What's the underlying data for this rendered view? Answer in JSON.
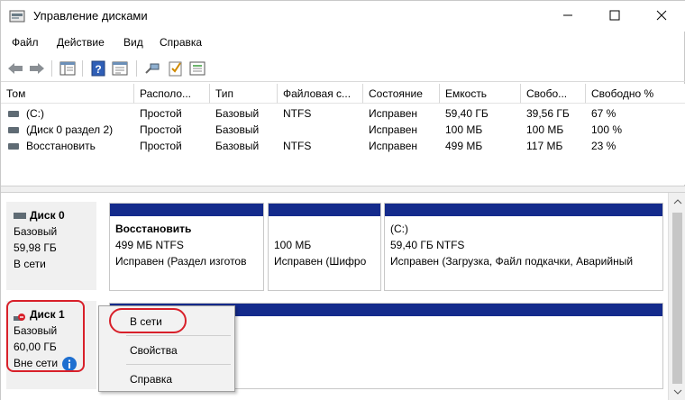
{
  "window": {
    "title": "Управление дисками",
    "icon": "disk-management-icon"
  },
  "menu": [
    "Файл",
    "Действие",
    "Вид",
    "Справка"
  ],
  "toolbar_icons": [
    "back-arrow-icon",
    "forward-arrow-icon",
    "console-tree-icon",
    "help-icon",
    "properties-icon",
    "refresh-icon",
    "checklist-icon",
    "list-view-icon"
  ],
  "columns": [
    "Том",
    "Располо...",
    "Тип",
    "Файловая с...",
    "Состояние",
    "Емкость",
    "Свобо...",
    "Свободно %"
  ],
  "volumes": [
    {
      "name": "(C:)",
      "layout": "Простой",
      "type": "Базовый",
      "fs": "NTFS",
      "status": "Исправен",
      "capacity": "59,40 ГБ",
      "free": "39,56 ГБ",
      "free_pct": "67 %"
    },
    {
      "name": "(Диск 0 раздел 2)",
      "layout": "Простой",
      "type": "Базовый",
      "fs": "",
      "status": "Исправен",
      "capacity": "100 МБ",
      "free": "100 МБ",
      "free_pct": "100 %"
    },
    {
      "name": "Восстановить",
      "layout": "Простой",
      "type": "Базовый",
      "fs": "NTFS",
      "status": "Исправен",
      "capacity": "499 МБ",
      "free": "117 МБ",
      "free_pct": "23 %"
    }
  ],
  "disks": [
    {
      "name": "Диск 0",
      "type": "Базовый",
      "size": "59,98 ГБ",
      "state": "В сети",
      "partitions": [
        {
          "title": "Восстановить",
          "size": "499 МБ NTFS",
          "status": "Исправен (Раздел изготов"
        },
        {
          "title": "",
          "size": "100 МБ",
          "status": "Исправен (Шифро"
        },
        {
          "title": "(C:)",
          "size": "59,40 ГБ NTFS",
          "status": "Исправен (Загрузка, Файл подкачки, Аварийный"
        }
      ]
    },
    {
      "name": "Диск 1",
      "type": "Базовый",
      "size": "60,00 ГБ",
      "state": "Вне сети"
    }
  ],
  "context_menu": [
    "В сети",
    "Свойства",
    "Справка"
  ],
  "colors": {
    "partition_bar": "#142b8c",
    "highlight": "#d8202a",
    "info_badge": "#1e6fd0"
  }
}
